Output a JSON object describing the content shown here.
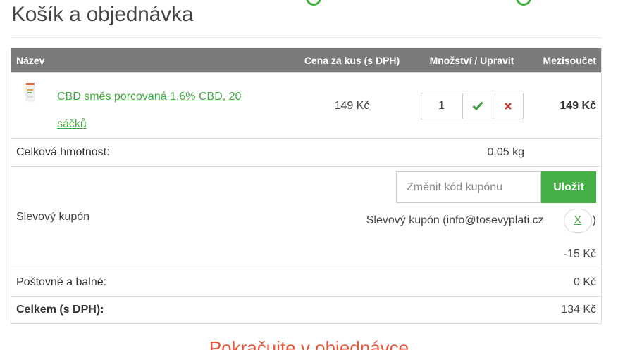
{
  "page": {
    "title": "Košík a objednávka"
  },
  "table": {
    "headers": {
      "name": "Název",
      "price": "Cena za kus (s DPH)",
      "qty": "Množství / Upravit",
      "subtotal": "Mezisoučet"
    },
    "items": [
      {
        "name": "CBD směs porcovaná 1,6% CBD, 20 sáčků",
        "price": "149 Kč",
        "quantity": "1",
        "subtotal": "149 Kč"
      }
    ]
  },
  "weight": {
    "label": "Celková hmotnost:",
    "value": "0,05 kg"
  },
  "coupon": {
    "label": "Slevový kupón",
    "placeholder": "Změnit kód kupónu",
    "save_label": "Uložit",
    "applied_text": "Slevový kupón (info@tosevyplati.cz",
    "remove_label": "X",
    "closing_paren": ")",
    "discount": "-15 Kč"
  },
  "shipping": {
    "label": "Poštovné a balné:",
    "value": "0 Kč"
  },
  "total": {
    "label": "Celkem (s DPH):",
    "value": "134 Kč"
  },
  "footer": {
    "continue_text": "Pokračujte v objednávce"
  },
  "colors": {
    "accent": "#45b045",
    "header_bg": "#7a7a7a",
    "remove": "#c0392b",
    "continue": "#e8553a"
  }
}
